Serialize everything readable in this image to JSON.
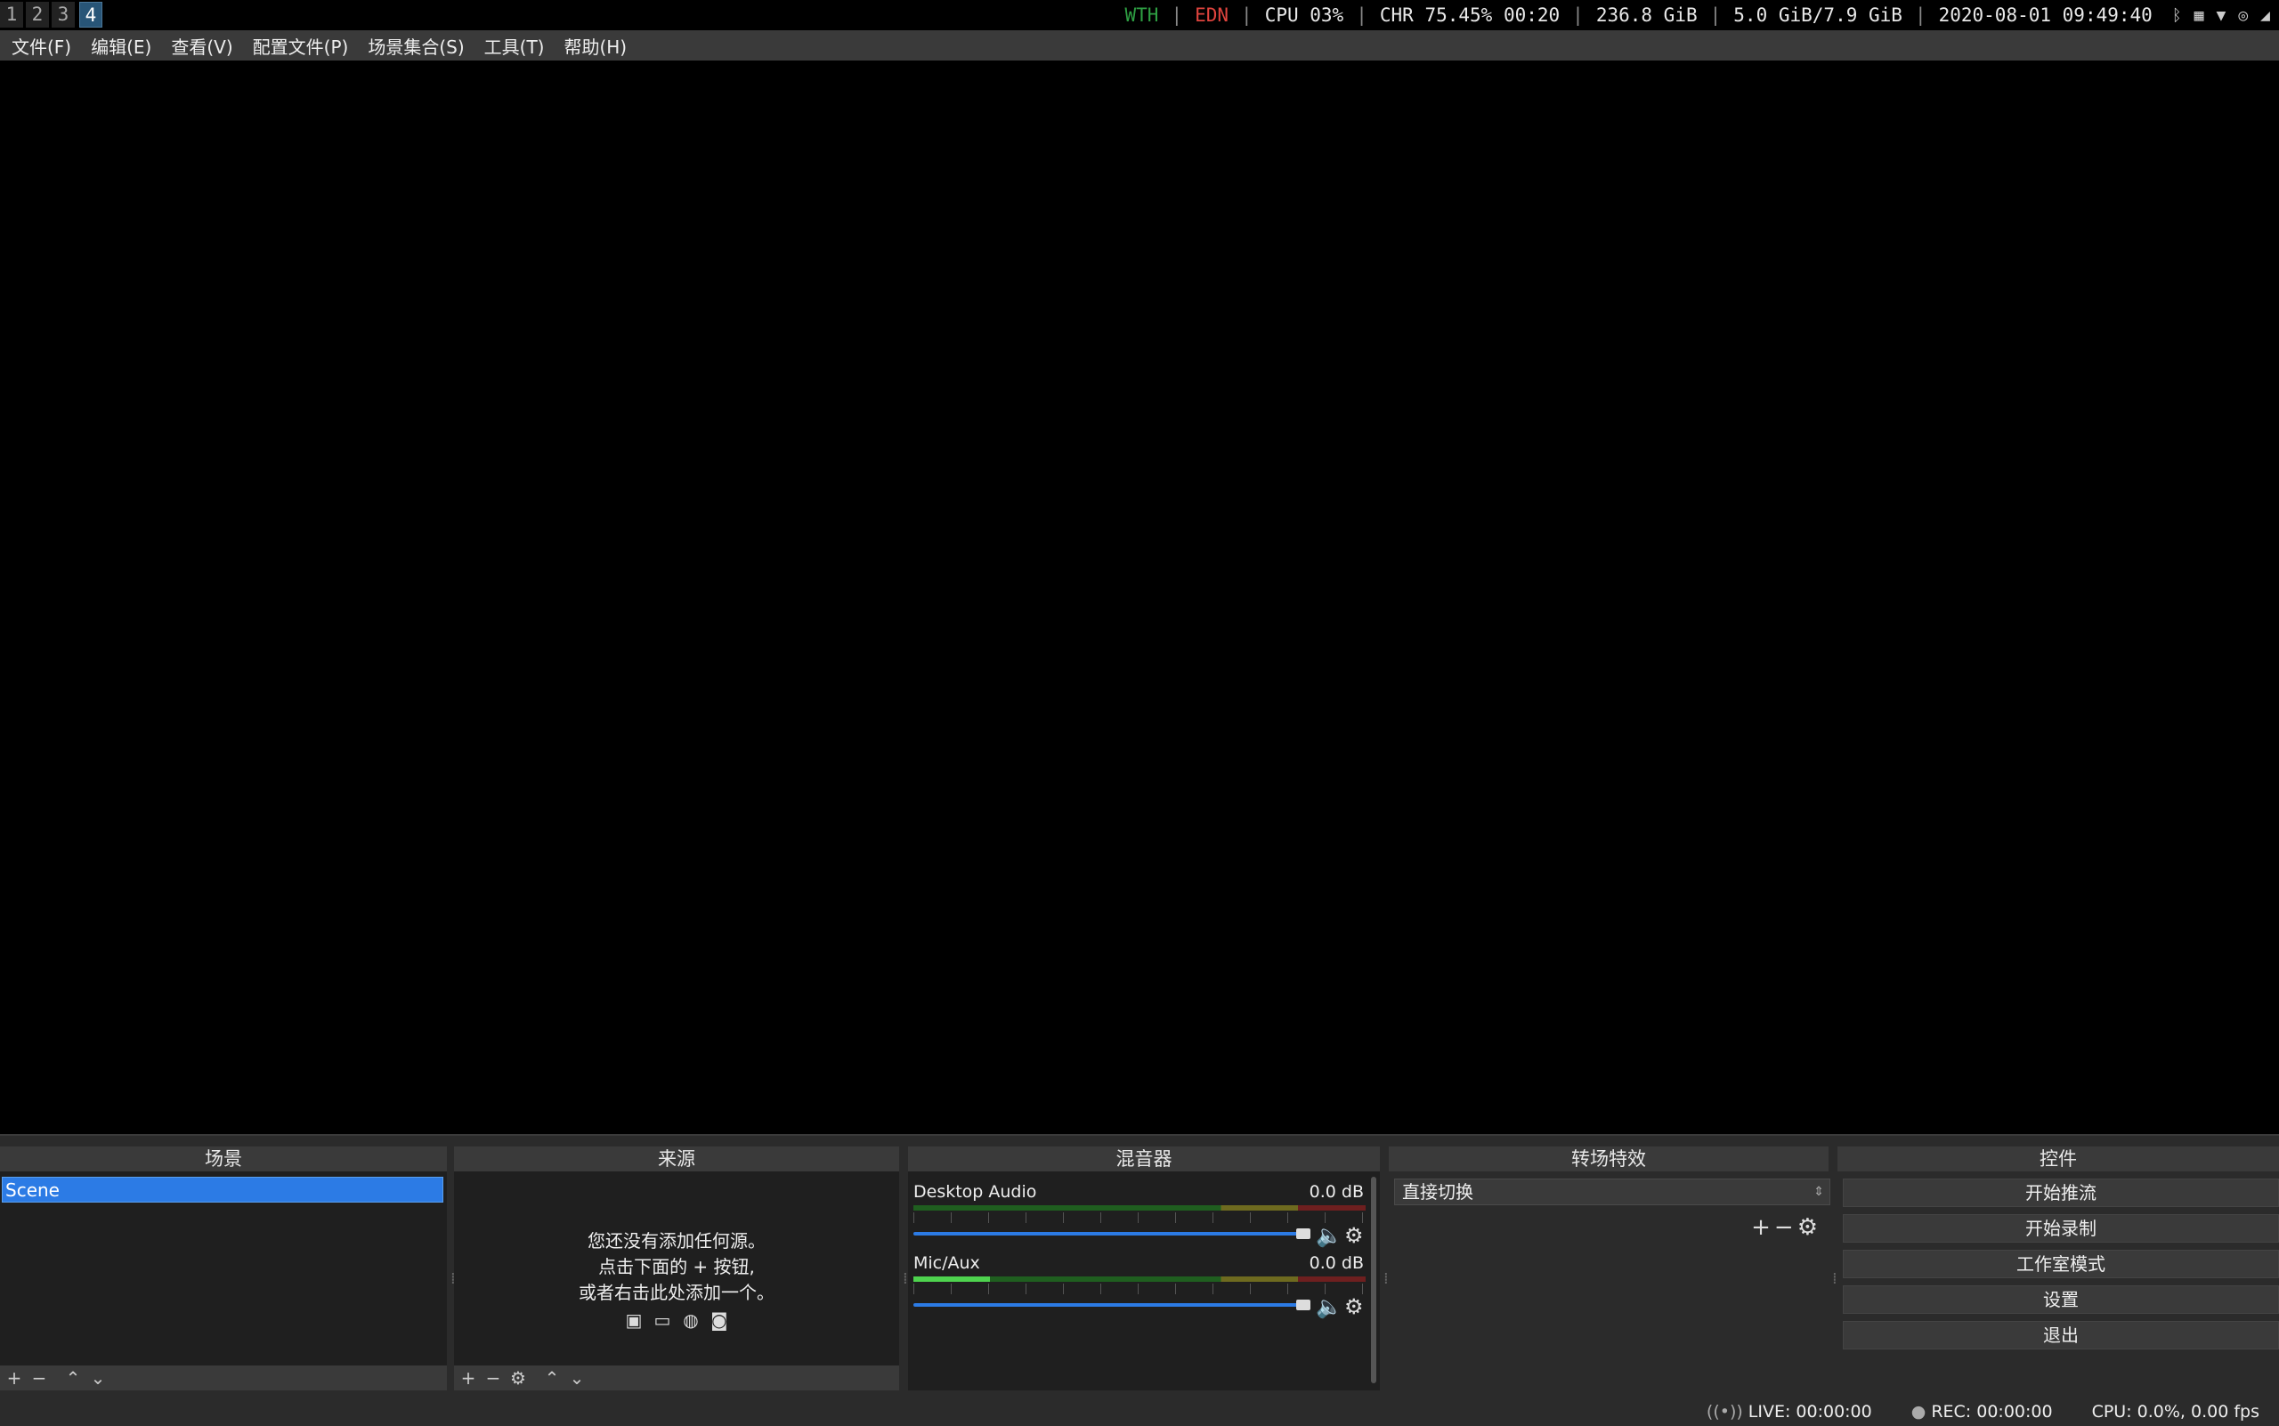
{
  "topbar": {
    "workspaces": [
      "1",
      "2",
      "3",
      "4"
    ],
    "active_workspace": "4",
    "wth": "WTH",
    "edn": "EDN",
    "cpu": "CPU 03%",
    "chr": "CHR 75.45% 00:20",
    "disk": "236.8 GiB",
    "mem": "5.0 GiB/7.9 GiB",
    "datetime": "2020-08-01 09:49:40",
    "colors": {
      "wth": "#2ea043",
      "edn": "#e0443e",
      "active_ws": "#285577"
    }
  },
  "menubar": {
    "items": [
      "文件(F)",
      "编辑(E)",
      "查看(V)",
      "配置文件(P)",
      "场景集合(S)",
      "工具(T)",
      "帮助(H)"
    ]
  },
  "docks": {
    "scenes": {
      "title": "场景",
      "items": [
        "Scene"
      ]
    },
    "sources": {
      "title": "来源",
      "empty_line1": "您还没有添加任何源。",
      "empty_line2": "点击下面的 + 按钮,",
      "empty_line3": "或者右击此处添加一个。"
    },
    "mixer": {
      "title": "混音器",
      "channels": [
        {
          "name": "Desktop Audio",
          "db": "0.0 dB",
          "level": 0.0,
          "volume": 1.0
        },
        {
          "name": "Mic/Aux",
          "db": "0.0 dB",
          "level": 0.17,
          "volume": 1.0
        }
      ]
    },
    "transitions": {
      "title": "转场特效",
      "selected": "直接切换"
    },
    "controls": {
      "title": "控件",
      "start_streaming": "开始推流",
      "start_recording": "开始录制",
      "studio_mode": "工作室模式",
      "settings": "设置",
      "exit": "退出"
    }
  },
  "statusbar": {
    "live": "LIVE: 00:00:00",
    "rec": "REC: 00:00:00",
    "cpu": "CPU: 0.0%, 0.00 fps"
  },
  "accent_color": "#2c7be5"
}
